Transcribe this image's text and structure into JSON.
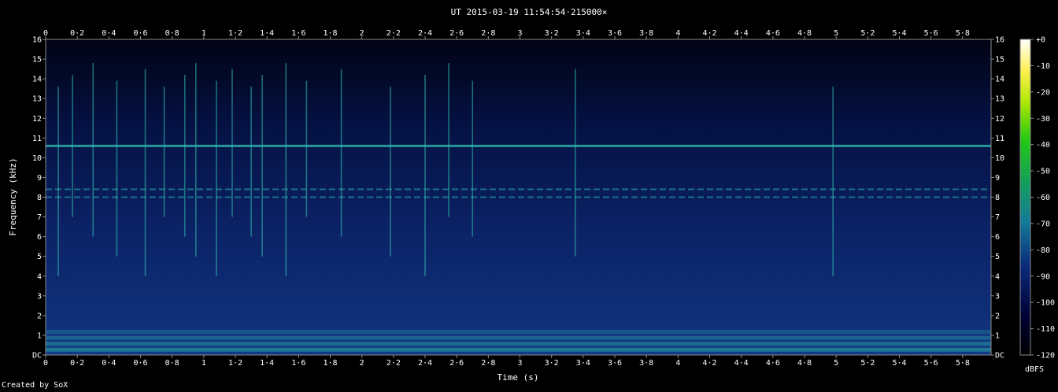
{
  "chart_data": {
    "type": "heatmap",
    "title": "UT 2015-03-19 11:54:54·215000×",
    "xlabel": "Time (s)",
    "ylabel": "Frequency (kHz)",
    "xlim": [
      0,
      5.98
    ],
    "ylim": [
      0,
      16
    ],
    "x_ticks": [
      "0",
      "0·2",
      "0·4",
      "0·6",
      "0·8",
      "1",
      "1·2",
      "1·4",
      "1·6",
      "1·8",
      "2",
      "2·2",
      "2·4",
      "2·6",
      "2·8",
      "3",
      "3·2",
      "3·4",
      "3·6",
      "3·8",
      "4",
      "4·2",
      "4·4",
      "4·6",
      "4·8",
      "5",
      "5·2",
      "5·4",
      "5·6",
      "5·8"
    ],
    "x_tick_values": [
      0,
      0.2,
      0.4,
      0.6,
      0.8,
      1.0,
      1.2,
      1.4,
      1.6,
      1.8,
      2.0,
      2.2,
      2.4,
      2.6,
      2.8,
      3.0,
      3.2,
      3.4,
      3.6,
      3.8,
      4.0,
      4.2,
      4.4,
      4.6,
      4.8,
      5.0,
      5.2,
      5.4,
      5.6,
      5.8
    ],
    "y_ticks": [
      "DC",
      "1",
      "2",
      "3",
      "4",
      "5",
      "6",
      "7",
      "8",
      "9",
      "10",
      "11",
      "12",
      "13",
      "14",
      "15",
      "16"
    ],
    "y_tick_values": [
      0,
      1,
      2,
      3,
      4,
      5,
      6,
      7,
      8,
      9,
      10,
      11,
      12,
      13,
      14,
      15,
      16
    ],
    "colorbar": {
      "label": "dBFS",
      "ticks": [
        "+0",
        "-10",
        "-20",
        "-30",
        "-40",
        "-50",
        "-60",
        "-70",
        "-80",
        "-90",
        "-100",
        "-110",
        "-120"
      ],
      "tick_values": [
        0,
        -10,
        -20,
        -30,
        -40,
        -50,
        -60,
        -70,
        -80,
        -90,
        -100,
        -110,
        -120
      ],
      "range": [
        -120,
        0
      ]
    },
    "features": {
      "tones_khz": [
        10.6,
        8.4,
        8.0
      ],
      "impulse_times_s": [
        0.08,
        0.17,
        0.3,
        0.45,
        0.63,
        0.75,
        0.88,
        0.95,
        1.08,
        1.18,
        1.3,
        1.37,
        1.52,
        1.65,
        1.87,
        2.18,
        2.4,
        2.55,
        2.7,
        3.35,
        4.98
      ]
    },
    "colors": {
      "background": "#000000",
      "low": "#00004a",
      "mid": "#1a6aa0",
      "high": "#33c3b0",
      "peak": "#ffffff"
    }
  },
  "footer": {
    "credit": "Created by SoX"
  }
}
